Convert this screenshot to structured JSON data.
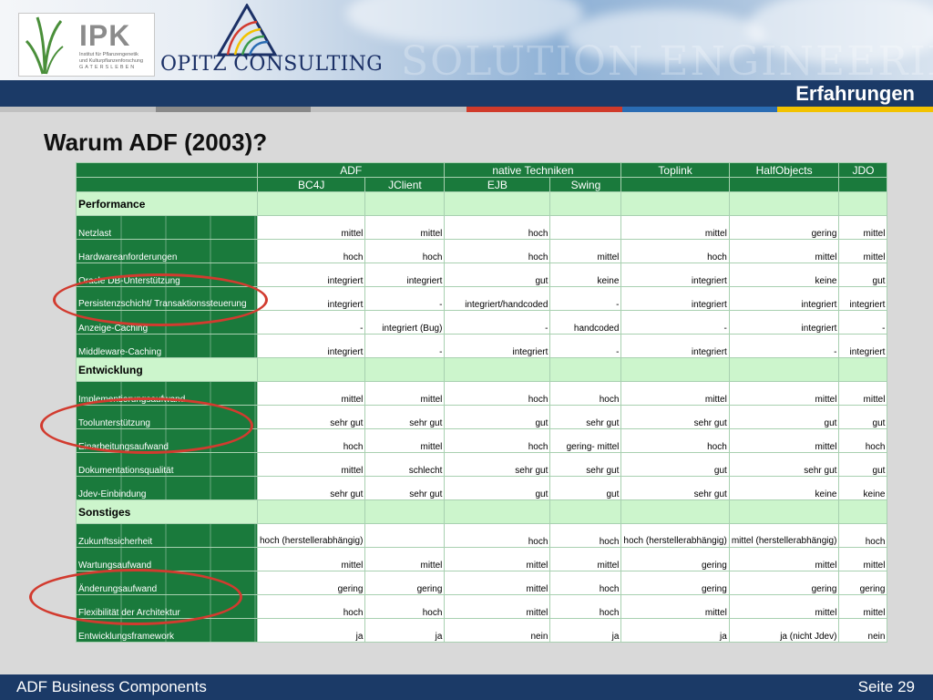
{
  "header": {
    "ipk_name": "IPK",
    "ipk_sub": [
      "Institut für Pflanzengenetik",
      "und Kulturpflanzenforschung",
      "GATERSLEBEN"
    ],
    "opitz_name": "OPITZ CONSULTING",
    "watermark": "SOLUTION ENGINEERING"
  },
  "section_title": "Erfahrungen",
  "colorstrip": [
    "#c0c0c0",
    "#8a8a8a",
    "#c0c0c0",
    "#d03a2a",
    "#2a6cb3",
    "#f2c200"
  ],
  "slide_title": "Warum ADF (2003)?",
  "table": {
    "groups": [
      "ADF",
      "native Techniken",
      "Toplink",
      "HalfObjects",
      "JDO"
    ],
    "subheaders": [
      "BC4J",
      "JClient",
      "EJB",
      "Swing"
    ],
    "sections": [
      {
        "title": "Performance",
        "rows": [
          {
            "label": "Netzlast",
            "values": [
              "mittel",
              "mittel",
              "hoch",
              "",
              "mittel",
              "gering",
              "mittel"
            ]
          },
          {
            "label": "Hardwareanforderungen",
            "values": [
              "hoch",
              "hoch",
              "hoch",
              "mittel",
              "hoch",
              "mittel",
              "mittel"
            ]
          },
          {
            "label": "Oracle DB-Unterstützung",
            "values": [
              "integriert",
              "integriert",
              "gut",
              "keine",
              "integriert",
              "keine",
              "gut"
            ]
          },
          {
            "label": "Persistenzschicht/ Transaktionssteuerung",
            "values": [
              "integriert",
              "-",
              "integriert/handcoded",
              "-",
              "integriert",
              "integriert",
              "integriert"
            ]
          },
          {
            "label": "Anzeige-Caching",
            "values": [
              "-",
              "integriert (Bug)",
              "-",
              "handcoded",
              "-",
              "integriert",
              "-"
            ]
          },
          {
            "label": "Middleware-Caching",
            "values": [
              "integriert",
              "-",
              "integriert",
              "-",
              "integriert",
              "-",
              "integriert"
            ]
          }
        ]
      },
      {
        "title": "Entwicklung",
        "rows": [
          {
            "label": "Implementierungsaufwand",
            "values": [
              "mittel",
              "mittel",
              "hoch",
              "hoch",
              "mittel",
              "mittel",
              "mittel"
            ]
          },
          {
            "label": "Toolunterstützung",
            "values": [
              "sehr gut",
              "sehr gut",
              "gut",
              "sehr gut",
              "sehr gut",
              "gut",
              "gut"
            ]
          },
          {
            "label": "Einarbeitungsaufwand",
            "values": [
              "hoch",
              "mittel",
              "hoch",
              "gering- mittel",
              "hoch",
              "mittel",
              "hoch"
            ]
          },
          {
            "label": "Dokumentationsqualität",
            "values": [
              "mittel",
              "schlecht",
              "sehr gut",
              "sehr gut",
              "gut",
              "sehr gut",
              "gut"
            ]
          },
          {
            "label": "Jdev-Einbindung",
            "values": [
              "sehr gut",
              "sehr gut",
              "gut",
              "gut",
              "sehr gut",
              "keine",
              "keine"
            ]
          }
        ]
      },
      {
        "title": "Sonstiges",
        "rows": [
          {
            "label": "Zukunftssicherheit",
            "values": [
              "hoch (herstellerabhängig)",
              "",
              "hoch",
              "hoch",
              "hoch (herstellerabhängig)",
              "mittel (herstellerabhängig)",
              "hoch"
            ]
          },
          {
            "label": "Wartungsaufwand",
            "values": [
              "mittel",
              "mittel",
              "mittel",
              "mittel",
              "gering",
              "mittel",
              "mittel"
            ]
          },
          {
            "label": "Änderungsaufwand",
            "values": [
              "gering",
              "gering",
              "mittel",
              "hoch",
              "gering",
              "gering",
              "gering"
            ]
          },
          {
            "label": "Flexibilität der Architektur",
            "values": [
              "hoch",
              "hoch",
              "mittel",
              "hoch",
              "mittel",
              "mittel",
              "mittel"
            ]
          },
          {
            "label": "Entwicklungsframework",
            "values": [
              "ja",
              "ja",
              "nein",
              "ja",
              "ja",
              "ja (nicht Jdev)",
              "nein"
            ]
          }
        ]
      }
    ]
  },
  "footer": {
    "left": "ADF Business Components",
    "right": "Seite 29"
  }
}
